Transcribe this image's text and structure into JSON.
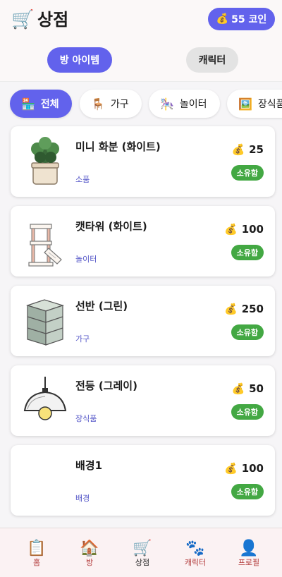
{
  "header": {
    "title": "상점",
    "logo_icon": "🛒",
    "coins": "55 코인",
    "coin_icon": "💰"
  },
  "segments": {
    "active": "방 아이템",
    "inactive": "캐릭터"
  },
  "chips": [
    {
      "icon": "🏪",
      "label": "전체"
    },
    {
      "icon": "🪑",
      "label": "가구"
    },
    {
      "icon": "🎠",
      "label": "놀이터"
    },
    {
      "icon": "🖼️",
      "label": "장식품"
    }
  ],
  "items": [
    {
      "name": "미니 화분 (화이트)",
      "category": "소품",
      "price": "25",
      "status": "소유함"
    },
    {
      "name": "캣타워 (화이트)",
      "category": "놀이터",
      "price": "100",
      "status": "소유함"
    },
    {
      "name": "선반 (그린)",
      "category": "가구",
      "price": "250",
      "status": "소유함"
    },
    {
      "name": "전등 (그레이)",
      "category": "장식품",
      "price": "50",
      "status": "소유함"
    },
    {
      "name": "배경1",
      "category": "배경",
      "price": "100",
      "status": "소유함"
    }
  ],
  "price_icon": "💰",
  "nav": [
    {
      "icon": "📋",
      "label": "홈"
    },
    {
      "icon": "🏠",
      "label": "방"
    },
    {
      "icon": "🛒",
      "label": "상점"
    },
    {
      "icon": "🐾",
      "label": "캐릭터"
    },
    {
      "icon": "👤",
      "label": "프로필"
    }
  ]
}
